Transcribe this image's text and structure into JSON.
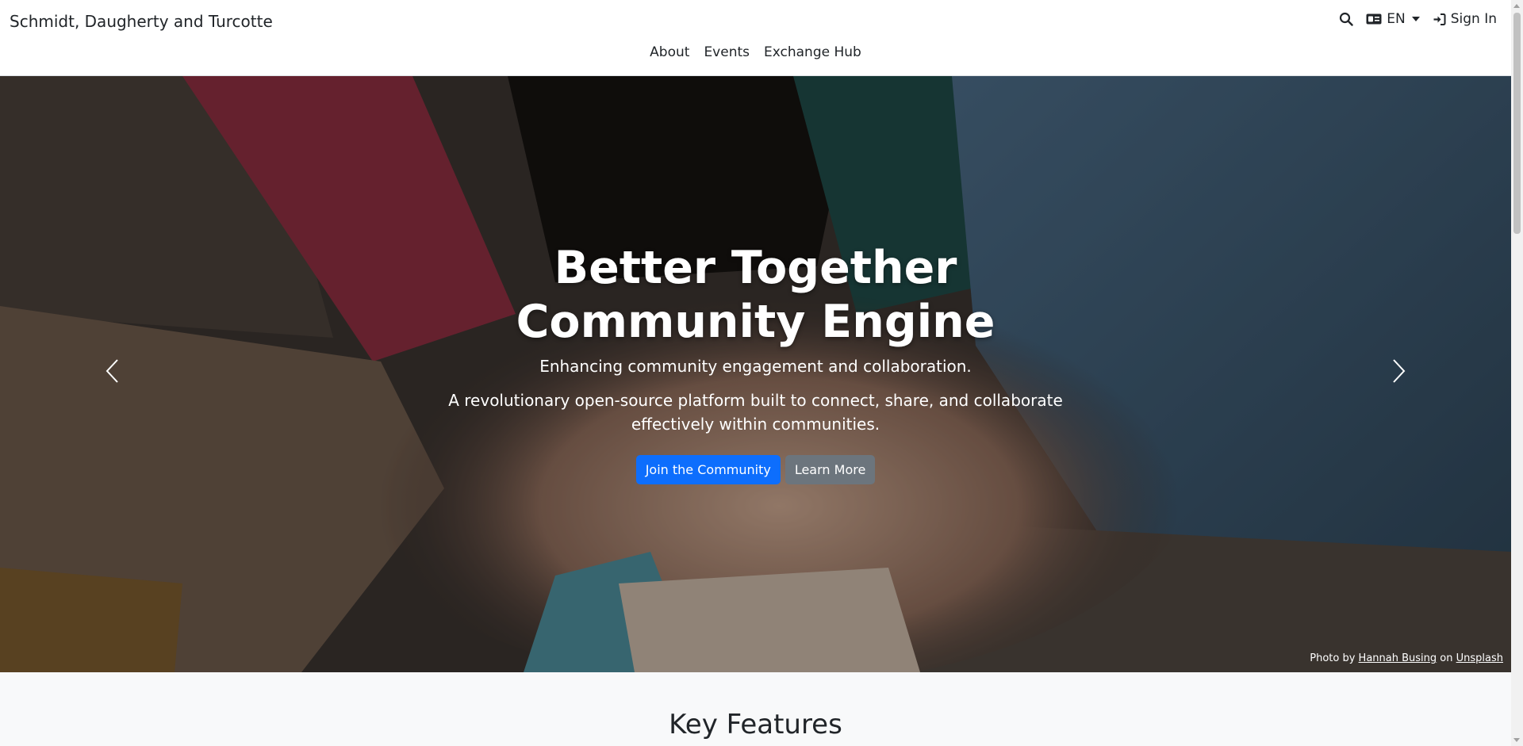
{
  "header": {
    "brand": "Schmidt, Daugherty and Turcotte",
    "language": "EN",
    "sign_in": "Sign In",
    "nav": [
      "About",
      "Events",
      "Exchange Hub"
    ]
  },
  "hero": {
    "title_line1": "Better Together",
    "title_line2": "Community Engine",
    "tagline": "Enhancing community engagement and collaboration.",
    "description": "A revolutionary open-source platform built to connect, share, and collaborate effectively within communities.",
    "primary_button": "Join the Community",
    "secondary_button": "Learn More",
    "credit_prefix": "Photo by",
    "credit_author": "Hannah Busing",
    "credit_mid": "on",
    "credit_site": "Unsplash"
  },
  "features": {
    "heading": "Key Features"
  },
  "colors": {
    "primary": "#0d6efd",
    "secondary": "#6c757d",
    "features_bg": "#f8f9fa"
  },
  "icons": {
    "search": "search-icon",
    "language": "language-icon",
    "sign_in": "sign-in-icon",
    "prev": "chevron-left-icon",
    "next": "chevron-right-icon"
  }
}
